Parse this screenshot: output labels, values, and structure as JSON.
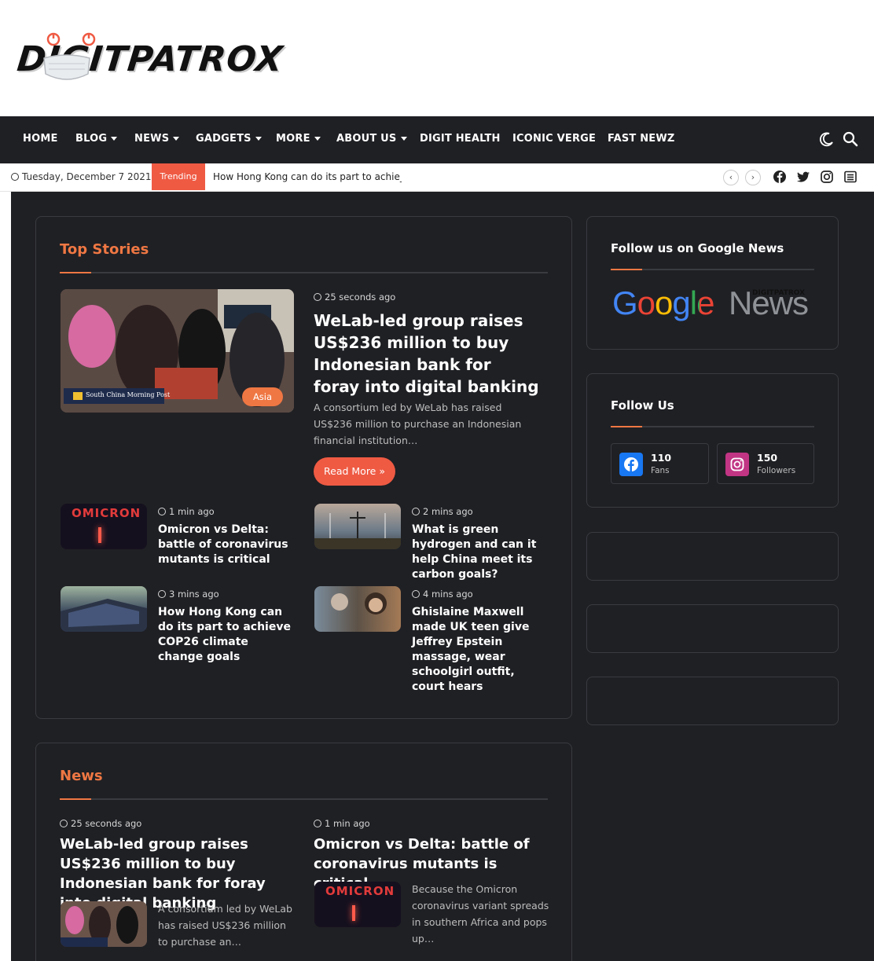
{
  "header": {
    "logo_text": "DIGITPATROX"
  },
  "nav": {
    "items": [
      "HOME",
      "BLOG",
      "NEWS",
      "GADGETS",
      "MORE",
      "ABOUT US",
      "DIGIT HEALTH",
      "ICONIC VERGE",
      "FAST NEWZ"
    ],
    "icons": [
      "moon-icon",
      "search-icon"
    ]
  },
  "topbar": {
    "date": "Tuesday, December 7 2021",
    "trending_label": "Trending",
    "trending_text": "How Hong Kong can do its part to achie_",
    "social_icons": [
      "facebook-icon",
      "twitter-icon",
      "instagram-icon",
      "menu-icon"
    ]
  },
  "top_stories": {
    "title": "Top Stories",
    "featured": {
      "time": "25 seconds ago",
      "title": "WeLab-led group raises US$236 million to buy Indonesian bank for foray into digital banking",
      "excerpt": "A consortium led by WeLab has raised US$236 million to purchase an Indonesian financial institution…",
      "category": "Asia",
      "read_more": "Read More »",
      "image_caption": "South China Morning Post"
    },
    "items": [
      {
        "time": "1 min ago",
        "title": "Omicron vs Delta: battle of coronavirus mutants is critical",
        "thumb_text": "OMICRON"
      },
      {
        "time": "2 mins ago",
        "title": "What is green hydrogen and can it help China meet its carbon goals?"
      },
      {
        "time": "3 mins ago",
        "title": "How Hong Kong can do its part to achieve COP26 climate change goals"
      },
      {
        "time": "4 mins ago",
        "title": "Ghislaine Maxwell made UK teen give Jeffrey Epstein massage, wear schoolgirl outfit, court hears"
      }
    ]
  },
  "news": {
    "title": "News",
    "items": [
      {
        "time": "25 seconds ago",
        "title": "WeLab-led group raises US$236 million to buy Indonesian bank for foray into digital banking",
        "excerpt": "A consortium led by WeLab has raised US$236 million to purchase an…"
      },
      {
        "time": "1 min ago",
        "title": "Omicron vs Delta: battle of coronavirus mutants is critical",
        "excerpt": "Because the Omicron coronavirus variant spreads in southern Africa and pops up…",
        "thumb_text": "OMICRON"
      }
    ]
  },
  "sidebar": {
    "google_news": {
      "title": "Follow us on Google News",
      "image_text_google": "Google",
      "image_text_news": "News",
      "image_overlay": "DIGITPATROX"
    },
    "follow_us": {
      "title": "Follow Us",
      "facebook": {
        "count": "110",
        "label": "Fans"
      },
      "instagram": {
        "count": "150",
        "label": "Followers"
      }
    }
  },
  "colors": {
    "accent": "#ef7743",
    "trending": "#ef5a43",
    "dark_bg": "#1f2024",
    "facebook": "#1877f2",
    "instagram": "#c13584"
  }
}
